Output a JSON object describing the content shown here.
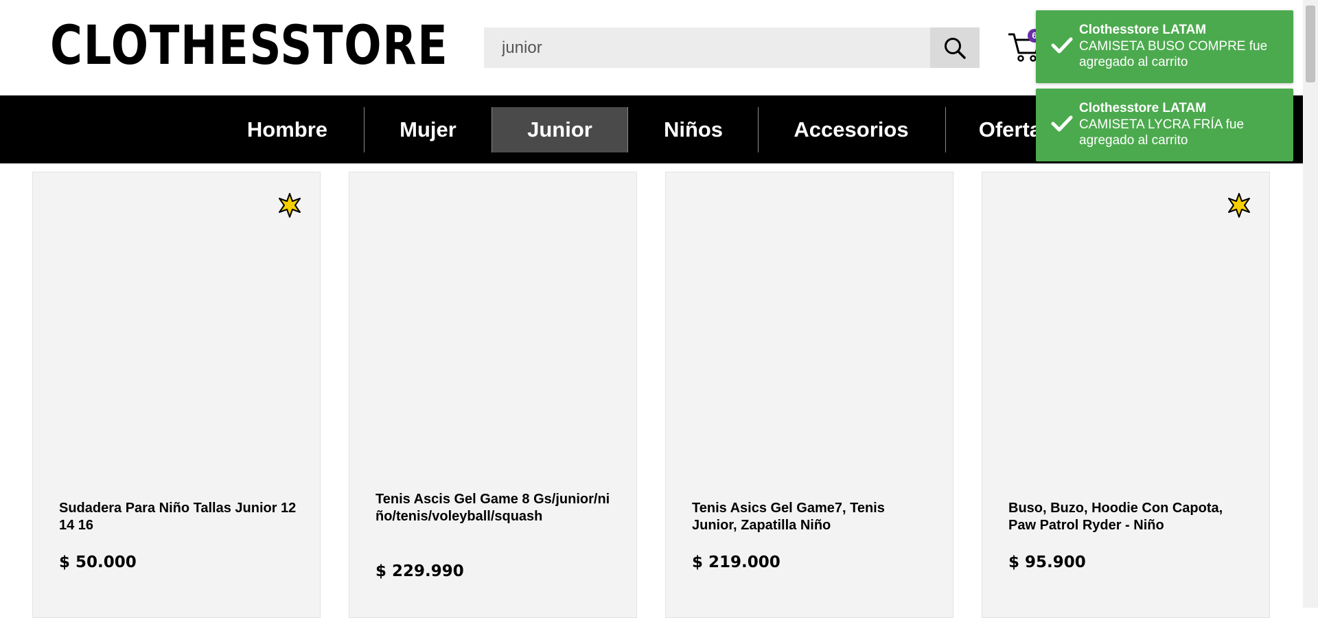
{
  "header": {
    "logo": "CLOTHESSTORE",
    "search": {
      "value": "junior",
      "icon": "search-icon"
    },
    "cart": {
      "icon": "cart-icon",
      "count": "6"
    }
  },
  "nav": {
    "items": [
      {
        "label": "Hombre",
        "active": false
      },
      {
        "label": "Mujer",
        "active": false
      },
      {
        "label": "Junior",
        "active": true
      },
      {
        "label": "Niños",
        "active": false
      },
      {
        "label": "Accesorios",
        "active": false
      },
      {
        "label": "Ofertas",
        "active": false
      }
    ]
  },
  "products": [
    {
      "name": "Sudadera Para Niño Tallas Junior 12 14 16",
      "price": "$ 50.000",
      "featured": true
    },
    {
      "name": "Tenis Ascis Gel Game 8 Gs/junior/niño/tenis/voleyball/squash",
      "price": "$ 229.990",
      "featured": false
    },
    {
      "name": "Tenis Asics Gel Game7, Tenis Junior, Zapatilla Niño",
      "price": "$ 219.000",
      "featured": false
    },
    {
      "name": "Buso, Buzo, Hoodie Con Capota, Paw Patrol Ryder - Niño",
      "price": "$ 95.900",
      "featured": true
    }
  ],
  "toasts": [
    {
      "title": "Clothesstore LATAM",
      "message": "CAMISETA BUSO COMPRE fue agregado al carrito"
    },
    {
      "title": "Clothesstore LATAM",
      "message": "CAMISETA LYCRA FRÍA fue agregado al carrito"
    }
  ],
  "colors": {
    "toast": "#4caa4e",
    "nav": "#000000",
    "nav_active": "#4a4a4a",
    "badge": "#6a2fa8",
    "star": "#f5d000"
  }
}
